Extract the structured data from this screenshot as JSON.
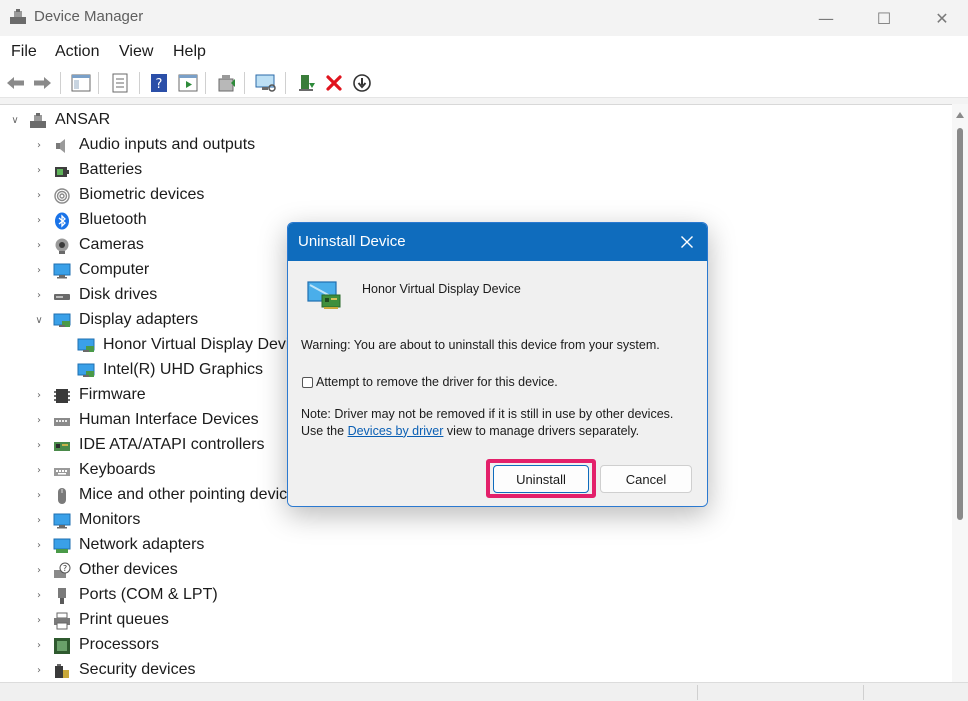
{
  "window": {
    "title": "Device Manager",
    "minimize_glyph": "—",
    "maximize_glyph": "☐",
    "close_glyph": "✕"
  },
  "menu": {
    "items": [
      "File",
      "Action",
      "View",
      "Help"
    ]
  },
  "toolbar": {
    "buttons": [
      "back-icon",
      "forward-icon",
      "show-hide-tree-icon",
      "properties-icon",
      "help-icon",
      "run-icon",
      "update-driver-icon",
      "scan-hardware-icon",
      "add-driver-icon",
      "uninstall-icon",
      "disable-device-icon"
    ]
  },
  "tree": {
    "root": "ANSAR",
    "categories": [
      {
        "label": "Audio inputs and outputs",
        "expanded": false
      },
      {
        "label": "Batteries",
        "expanded": false
      },
      {
        "label": "Biometric devices",
        "expanded": false
      },
      {
        "label": "Bluetooth",
        "expanded": false
      },
      {
        "label": "Cameras",
        "expanded": false
      },
      {
        "label": "Computer",
        "expanded": false
      },
      {
        "label": "Disk drives",
        "expanded": false
      },
      {
        "label": "Display adapters",
        "expanded": true
      },
      {
        "label": "Honor Virtual Display Device",
        "child": true
      },
      {
        "label": "Intel(R) UHD Graphics",
        "child": true
      },
      {
        "label": "Firmware",
        "expanded": false
      },
      {
        "label": "Human Interface Devices",
        "expanded": false
      },
      {
        "label": "IDE ATA/ATAPI controllers",
        "expanded": false
      },
      {
        "label": "Keyboards",
        "expanded": false
      },
      {
        "label": "Mice and other pointing devices",
        "expanded": false
      },
      {
        "label": "Monitors",
        "expanded": false
      },
      {
        "label": "Network adapters",
        "expanded": false
      },
      {
        "label": "Other devices",
        "expanded": false
      },
      {
        "label": "Ports (COM & LPT)",
        "expanded": false
      },
      {
        "label": "Print queues",
        "expanded": false
      },
      {
        "label": "Processors",
        "expanded": false
      },
      {
        "label": "Security devices",
        "expanded": false
      }
    ]
  },
  "dialog": {
    "title": "Uninstall Device",
    "device_name": "Honor Virtual Display Device",
    "warning": "Warning: You are about to uninstall this device from your system.",
    "checkbox_label": "Attempt to remove the driver for this device.",
    "checkbox_checked": false,
    "note_prefix": "Note: Driver may not be removed if it is still in use by other devices. Use the ",
    "note_link": "Devices by driver",
    "note_suffix": " view to manage drivers separately.",
    "uninstall_label": "Uninstall",
    "cancel_label": "Cancel",
    "highlight_color": "#e3206a",
    "accent_color": "#0f6cbd"
  }
}
